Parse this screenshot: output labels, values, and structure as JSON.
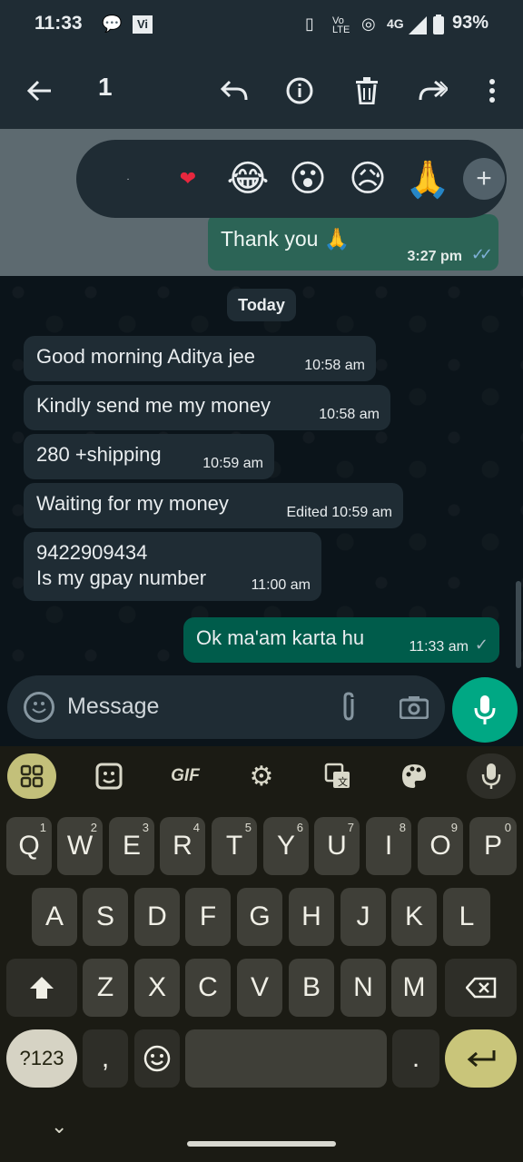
{
  "status_bar": {
    "time": "11:33",
    "battery": "93%",
    "network": "4G",
    "carrier_badge": "Vi"
  },
  "action_bar": {
    "selected_count": "1"
  },
  "reactions": [
    "·",
    "❤",
    "😂",
    "😮",
    "😥",
    "🙏",
    "+"
  ],
  "quoted_message": {
    "text": "Thank you 🙏",
    "time": "3:27 pm"
  },
  "date_chip": "Today",
  "messages": [
    {
      "text": "Good morning Aditya jee",
      "time": "10:58 am"
    },
    {
      "text": "Kindly send me my money",
      "time": "10:58 am"
    },
    {
      "text": "280 +shipping",
      "time": "10:59 am"
    },
    {
      "text": "Waiting for my money",
      "time": "Edited 10:59 am"
    },
    {
      "text_line1": "9422909434",
      "text_line2": "Is my gpay number",
      "time": "11:00 am"
    },
    {
      "text": "Ok ma'am karta hu",
      "time": "11:33 am",
      "outgoing": true
    }
  ],
  "composer": {
    "placeholder": "Message"
  },
  "keyboard": {
    "toolbar": [
      "apps",
      "sticker",
      "GIF",
      "settings",
      "translate",
      "theme",
      "mic"
    ],
    "row1": [
      [
        "Q",
        "1"
      ],
      [
        "W",
        "2"
      ],
      [
        "E",
        "3"
      ],
      [
        "R",
        "4"
      ],
      [
        "T",
        "5"
      ],
      [
        "Y",
        "6"
      ],
      [
        "U",
        "7"
      ],
      [
        "I",
        "8"
      ],
      [
        "O",
        "9"
      ],
      [
        "P",
        "0"
      ]
    ],
    "row2": [
      "A",
      "S",
      "D",
      "F",
      "G",
      "H",
      "J",
      "K",
      "L"
    ],
    "row3": [
      "Z",
      "X",
      "C",
      "V",
      "B",
      "N",
      "M"
    ],
    "symbols_key": "?123",
    "comma": ",",
    "period": "."
  },
  "colors": {
    "incoming_bubble": "#1f2c34",
    "outgoing_bubble": "#005c4b",
    "accent": "#00a884"
  }
}
